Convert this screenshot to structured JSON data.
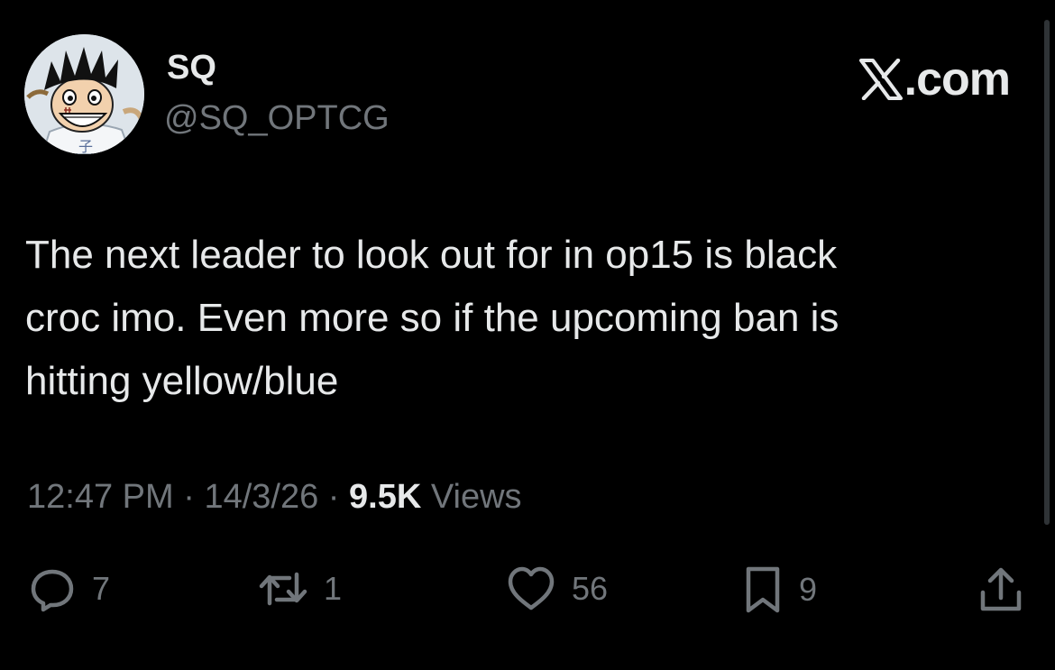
{
  "author": {
    "display_name": "SQ",
    "handle": "@SQ_OPTCG"
  },
  "brand": {
    "text": ".com"
  },
  "tweet": {
    "text": "The next leader to look out for in op15 is black\ncroc imo. Even more so if the upcoming ban is\nhitting yellow/blue"
  },
  "meta": {
    "time": "12:47 PM",
    "separator": "·",
    "date": "14/3/26",
    "views_count": "9.5K",
    "views_label": "Views"
  },
  "actions": {
    "replies": "7",
    "reposts": "1",
    "likes": "56",
    "bookmarks": "9"
  },
  "colors": {
    "background": "#000000",
    "primary_text": "#e7e9ea",
    "secondary_text": "#71767b"
  }
}
